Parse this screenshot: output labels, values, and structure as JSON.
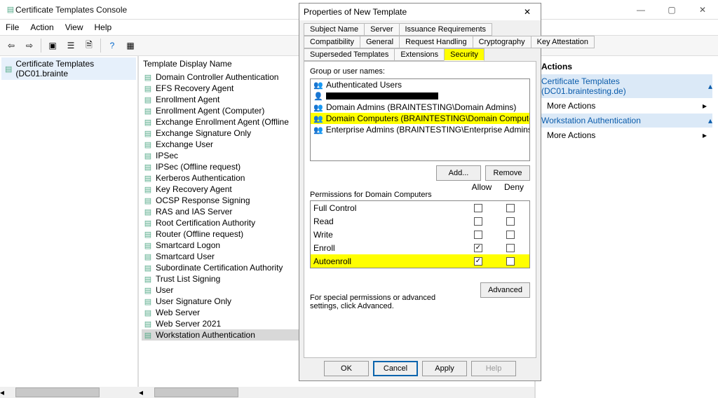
{
  "window": {
    "title": "Certificate Templates Console",
    "minimize": "—",
    "maximize": "▢",
    "close": "✕"
  },
  "menu": {
    "file": "File",
    "action": "Action",
    "view": "View",
    "help": "Help"
  },
  "nav": {
    "root": "Certificate Templates (DC01.brainte"
  },
  "mid": {
    "header": "Template Display Name",
    "items": [
      "Domain Controller Authentication",
      "EFS Recovery Agent",
      "Enrollment Agent",
      "Enrollment Agent (Computer)",
      "Exchange Enrollment Agent (Offline",
      "Exchange Signature Only",
      "Exchange User",
      "IPSec",
      "IPSec (Offline request)",
      "Kerberos Authentication",
      "Key Recovery Agent",
      "OCSP Response Signing",
      "RAS and IAS Server",
      "Root Certification Authority",
      "Router (Offline request)",
      "Smartcard Logon",
      "Smartcard User",
      "Subordinate Certification Authority",
      "Trust List Signing",
      "User",
      "User Signature Only",
      "Web Server",
      "Web Server 2021",
      "Workstation Authentication"
    ],
    "selected_index": 23
  },
  "right": {
    "header": "Actions",
    "group1_title": "Certificate Templates (DC01.braintesting.de)",
    "more1": "More Actions",
    "group2_title": "Workstation Authentication",
    "more2": "More Actions"
  },
  "dialog": {
    "title": "Properties of New Template",
    "tabs_row1": [
      "Subject Name",
      "Server",
      "Issuance Requirements"
    ],
    "tabs_row2": [
      "Compatibility",
      "General",
      "Request Handling",
      "Cryptography",
      "Key Attestation"
    ],
    "tabs_row3": [
      "Superseded Templates",
      "Extensions",
      "Security"
    ],
    "group_label": "Group or user names:",
    "groups": [
      {
        "name": "Authenticated Users",
        "type": "grp"
      },
      {
        "name": "",
        "type": "user",
        "redacted": true
      },
      {
        "name": "Domain Admins (BRAINTESTING\\Domain Admins)",
        "type": "grp"
      },
      {
        "name": "Domain Computers (BRAINTESTING\\Domain Computers)",
        "type": "grp",
        "highlight": true,
        "selected": true
      },
      {
        "name": "Enterprise Admins (BRAINTESTING\\Enterprise Admins)",
        "type": "grp"
      }
    ],
    "add": "Add...",
    "remove": "Remove",
    "perm_label": "Permissions for Domain Computers",
    "allow": "Allow",
    "deny": "Deny",
    "perms": [
      {
        "name": "Full Control",
        "allow": false,
        "deny": false
      },
      {
        "name": "Read",
        "allow": false,
        "deny": false
      },
      {
        "name": "Write",
        "allow": false,
        "deny": false
      },
      {
        "name": "Enroll",
        "allow": true,
        "deny": false
      },
      {
        "name": "Autoenroll",
        "allow": true,
        "deny": false,
        "highlight": true
      }
    ],
    "adv_text": "For special permissions or advanced settings, click Advanced.",
    "advanced": "Advanced",
    "ok": "OK",
    "cancel": "Cancel",
    "apply": "Apply",
    "help": "Help"
  }
}
